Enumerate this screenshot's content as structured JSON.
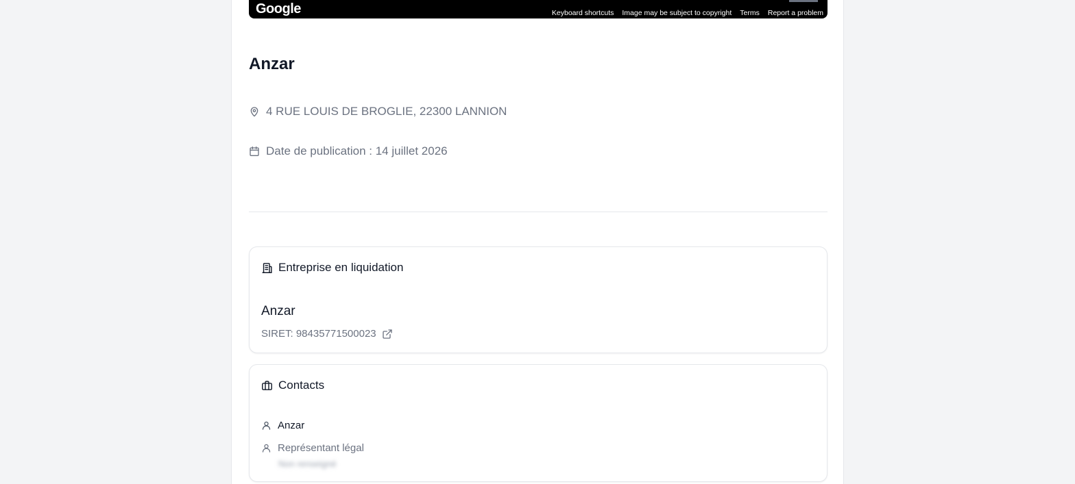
{
  "map": {
    "logo": "Google",
    "links": [
      "Keyboard shortcuts",
      "Image may be subject to copyright",
      "Terms",
      "Report a problem"
    ]
  },
  "listing": {
    "title": "Anzar",
    "address": "4 RUE LOUIS DE BROGLIE, 22300 LANNION",
    "publication_date": "Date de publication : 14 juillet 2026"
  },
  "company_card": {
    "heading": "Entreprise en liquidation",
    "icon": "building-icon",
    "name": "Anzar",
    "siret": "SIRET: 98435771500023"
  },
  "contacts_card": {
    "heading": "Contacts",
    "icon": "briefcase-icon",
    "contacts": [
      {
        "name": "Anzar",
        "icon": "user-icon"
      },
      {
        "role": "Représentant légal",
        "detail": "Non renseigné",
        "icon": "user-icon"
      }
    ]
  }
}
